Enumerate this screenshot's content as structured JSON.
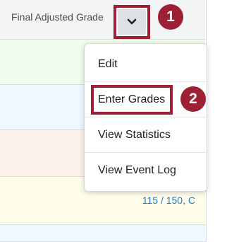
{
  "header": {
    "column_title": "Final Adjusted Grade"
  },
  "row_grade": "115 / 150, C",
  "menu": {
    "items": [
      {
        "label": "Edit"
      },
      {
        "label": "Enter Grades"
      },
      {
        "label": "View Statistics"
      },
      {
        "label": "View Event Log"
      }
    ]
  },
  "callouts": {
    "one": "1",
    "two": "2"
  },
  "colors": {
    "accent": "#9d2035",
    "link": "#1c7cc7"
  }
}
